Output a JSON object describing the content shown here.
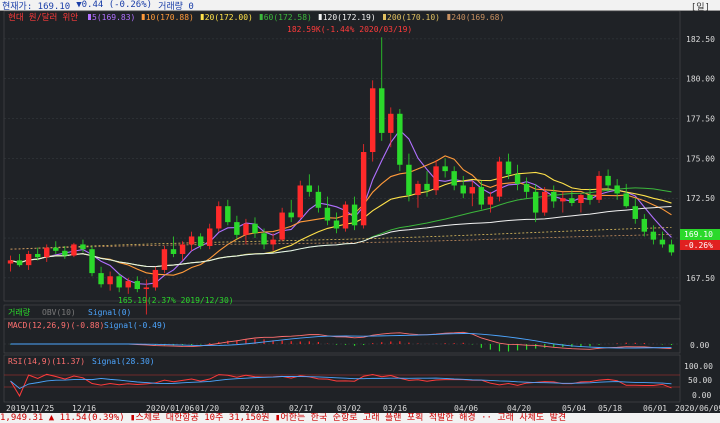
{
  "topbar": {
    "price_label": "현재가: 169.10",
    "change_label": "▼0.44 (-0.26%)",
    "volume_label": "거래량 0",
    "right_label": "[일]"
  },
  "legend": {
    "title": "현대 원/달러 위안",
    "ma": [
      {
        "label": "5(169.83)",
        "color": "#b070ff"
      },
      {
        "label": "10(170.88)",
        "color": "#ff9a3a"
      },
      {
        "label": "20(172.00)",
        "color": "#ffe24a"
      },
      {
        "label": "60(172.58)",
        "color": "#3cb83c"
      },
      {
        "label": "120(172.19)",
        "color": "#f2f2f2"
      },
      {
        "label": "200(170.10)",
        "color": "#e0c060"
      },
      {
        "label": "240(169.68)",
        "color": "#c89060"
      }
    ]
  },
  "annotations": {
    "high": "182.59K(-1.44% 2020/03/19)",
    "low": "165.19(2.37% 2019/12/30)"
  },
  "price_axis": {
    "ticks": [
      "182.50",
      "180.00",
      "177.50",
      "175.00",
      "172.50",
      "170.00",
      "167.50"
    ]
  },
  "current_price": {
    "value": "169.10",
    "change": "-0.26%"
  },
  "volume_panel": {
    "label1": "거래량",
    "label2": "OBV(10)",
    "label3": "Signal(0)"
  },
  "macd_panel": {
    "label": "MACD(12,26,9)(-0.88)",
    "signal": "Signal(-0.49)",
    "tick": "0.00"
  },
  "rsi_panel": {
    "label": "RSI(14,9)(11.37)",
    "signal": "Signal(28.30)",
    "ticks": [
      "100.00",
      "50.00",
      "0.00"
    ]
  },
  "date_axis": [
    "2019/11/25",
    "12/16",
    "2020/01/06",
    "01/20",
    "02/03",
    "02/17",
    "03/02",
    "03/16",
    "04/06",
    "04/20",
    "05/04",
    "05/18",
    "06/01",
    "2020/06/09"
  ],
  "ticker_text": "1,949.31 ▲ 11.54(0.39%)  ▮스체로 대한항공 10주 31,150원  ▮어한는 한국 순항로 고래 플랜 포획 적발한 해경 ·· 고래 사체도 발견",
  "colors": {
    "up": "#ff2a2a",
    "down": "#2bd92b",
    "bg": "#1f2226",
    "grid": "#3a3f45"
  },
  "chart_data": {
    "type": "candlestick",
    "x_range": [
      "2019/11/25",
      "2020/06/09"
    ],
    "ylim": [
      166.3,
      184.0
    ],
    "candles": [
      [
        168.4,
        168.9,
        167.9,
        168.6
      ],
      [
        168.6,
        169.0,
        168.2,
        168.3
      ],
      [
        168.3,
        169.2,
        168.0,
        169.0
      ],
      [
        169.0,
        169.4,
        168.6,
        168.8
      ],
      [
        168.8,
        169.6,
        168.5,
        169.4
      ],
      [
        169.4,
        169.8,
        169.0,
        169.2
      ],
      [
        169.2,
        169.5,
        168.7,
        168.9
      ],
      [
        168.9,
        169.7,
        168.8,
        169.6
      ],
      [
        169.6,
        169.9,
        169.1,
        169.3
      ],
      [
        169.3,
        169.5,
        167.6,
        167.8
      ],
      [
        167.8,
        168.2,
        166.9,
        167.1
      ],
      [
        167.1,
        167.9,
        166.7,
        167.6
      ],
      [
        167.6,
        167.8,
        166.6,
        166.9
      ],
      [
        166.9,
        167.5,
        166.5,
        167.3
      ],
      [
        167.3,
        167.6,
        166.6,
        166.8
      ],
      [
        166.8,
        167.4,
        165.2,
        166.9
      ],
      [
        166.9,
        168.2,
        166.7,
        168.0
      ],
      [
        168.0,
        169.5,
        167.8,
        169.3
      ],
      [
        169.3,
        170.1,
        168.8,
        169.0
      ],
      [
        169.0,
        169.8,
        168.6,
        169.6
      ],
      [
        169.6,
        170.4,
        169.2,
        170.1
      ],
      [
        170.1,
        170.3,
        169.3,
        169.5
      ],
      [
        169.5,
        170.9,
        169.3,
        170.6
      ],
      [
        170.6,
        172.3,
        170.4,
        172.0
      ],
      [
        172.0,
        172.4,
        170.8,
        171.0
      ],
      [
        171.0,
        171.4,
        169.9,
        170.2
      ],
      [
        170.2,
        171.2,
        169.6,
        170.9
      ],
      [
        170.9,
        171.3,
        170.0,
        170.3
      ],
      [
        170.3,
        170.6,
        169.3,
        169.6
      ],
      [
        169.6,
        170.3,
        169.2,
        169.9
      ],
      [
        169.9,
        171.9,
        169.8,
        171.6
      ],
      [
        171.6,
        172.4,
        171.0,
        171.3
      ],
      [
        171.3,
        173.6,
        171.2,
        173.3
      ],
      [
        173.3,
        174.0,
        172.6,
        172.9
      ],
      [
        172.9,
        173.3,
        171.6,
        171.9
      ],
      [
        171.9,
        172.6,
        170.8,
        171.1
      ],
      [
        171.1,
        171.6,
        170.3,
        170.6
      ],
      [
        170.6,
        172.3,
        170.4,
        172.1
      ],
      [
        172.1,
        172.6,
        170.5,
        170.8
      ],
      [
        170.8,
        175.9,
        170.6,
        175.4
      ],
      [
        175.4,
        179.9,
        174.8,
        179.4
      ],
      [
        179.4,
        182.6,
        176.1,
        176.6
      ],
      [
        176.6,
        178.2,
        175.7,
        177.8
      ],
      [
        177.8,
        178.1,
        174.2,
        174.6
      ],
      [
        174.6,
        175.3,
        172.3,
        172.7
      ],
      [
        172.7,
        173.6,
        171.9,
        173.4
      ],
      [
        173.4,
        174.2,
        172.6,
        173.0
      ],
      [
        173.0,
        174.9,
        172.7,
        174.5
      ],
      [
        174.5,
        175.0,
        173.8,
        174.2
      ],
      [
        174.2,
        174.5,
        173.0,
        173.3
      ],
      [
        173.3,
        173.9,
        172.5,
        172.8
      ],
      [
        172.8,
        173.6,
        172.0,
        173.2
      ],
      [
        173.2,
        173.6,
        171.8,
        172.1
      ],
      [
        172.1,
        172.9,
        171.6,
        172.6
      ],
      [
        172.6,
        175.1,
        172.3,
        174.8
      ],
      [
        174.8,
        175.3,
        173.7,
        174.0
      ],
      [
        174.0,
        174.6,
        173.0,
        173.4
      ],
      [
        173.4,
        173.8,
        172.5,
        172.9
      ],
      [
        172.9,
        173.4,
        171.0,
        171.6
      ],
      [
        171.6,
        173.2,
        171.4,
        172.9
      ],
      [
        172.9,
        173.3,
        171.9,
        172.3
      ],
      [
        172.3,
        172.9,
        171.6,
        172.5
      ],
      [
        172.5,
        173.0,
        172.0,
        172.2
      ],
      [
        172.2,
        172.8,
        171.6,
        172.7
      ],
      [
        172.7,
        173.1,
        172.1,
        172.4
      ],
      [
        172.4,
        174.2,
        172.2,
        173.9
      ],
      [
        173.9,
        174.3,
        172.9,
        173.3
      ],
      [
        173.3,
        173.7,
        172.4,
        172.8
      ],
      [
        172.8,
        173.4,
        171.9,
        172.0
      ],
      [
        172.0,
        172.5,
        170.9,
        171.2
      ],
      [
        171.2,
        171.5,
        170.1,
        170.4
      ],
      [
        170.4,
        170.8,
        169.6,
        169.9
      ],
      [
        169.9,
        170.4,
        169.4,
        169.6
      ],
      [
        169.6,
        169.9,
        168.9,
        169.1
      ]
    ]
  }
}
